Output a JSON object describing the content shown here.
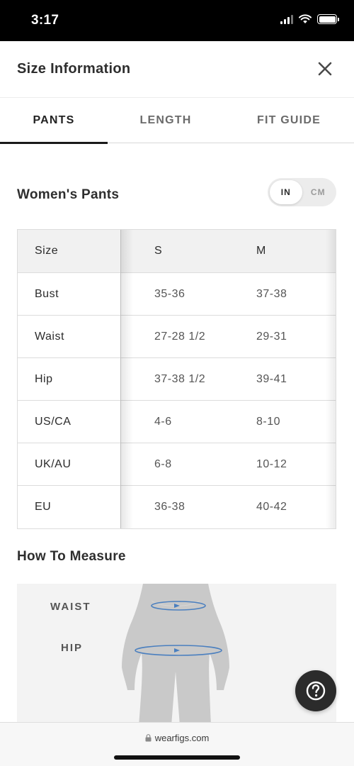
{
  "status_bar": {
    "time": "3:17"
  },
  "header": {
    "title": "Size Information",
    "close_icon": "close-icon"
  },
  "tabs": [
    {
      "label": "PANTS",
      "active": true
    },
    {
      "label": "LENGTH",
      "active": false
    },
    {
      "label": "FIT GUIDE",
      "active": false
    }
  ],
  "section": {
    "title": "Women's Pants",
    "unit_toggle": {
      "options": [
        "IN",
        "CM"
      ],
      "selected": "IN"
    }
  },
  "size_table": {
    "headers": [
      "Size",
      "S",
      "M"
    ],
    "rows": [
      [
        "Bust",
        "35-36",
        "37-38"
      ],
      [
        "Waist",
        "27-28 1/2",
        "29-31"
      ],
      [
        "Hip",
        "37-38 1/2",
        "39-41"
      ],
      [
        "US/CA",
        "4-6",
        "8-10"
      ],
      [
        "UK/AU",
        "6-8",
        "10-12"
      ],
      [
        "EU",
        "36-38",
        "40-42"
      ]
    ]
  },
  "how_to_measure": {
    "title": "How To Measure",
    "labels": {
      "waist": "WAIST",
      "hip": "HIP"
    }
  },
  "help_button": {
    "icon": "question-icon"
  },
  "url_bar": {
    "domain": "wearfigs.com",
    "icon": "lock-icon"
  },
  "colors": {
    "accent": "#1a1a1a",
    "help_button_bg": "#2b2b2b",
    "measure_line": "#4a7fbf"
  }
}
